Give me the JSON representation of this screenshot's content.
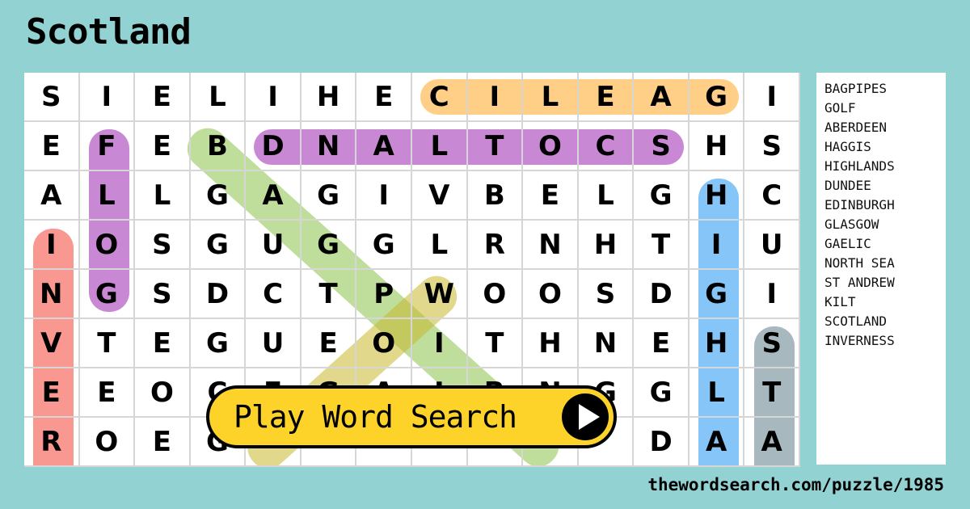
{
  "title": "Scotland",
  "grid": [
    [
      "S",
      "I",
      "E",
      "L",
      "I",
      "H",
      "E",
      "C",
      "I",
      "L",
      "E",
      "A",
      "G",
      "I"
    ],
    [
      "E",
      "F",
      "E",
      "B",
      "D",
      "N",
      "A",
      "L",
      "T",
      "O",
      "C",
      "S",
      "H",
      "S"
    ],
    [
      "A",
      "L",
      "L",
      "G",
      "A",
      "G",
      "I",
      "V",
      "B",
      "E",
      "L",
      "G",
      "H",
      "C"
    ],
    [
      "I",
      "O",
      "S",
      "G",
      "U",
      "G",
      "G",
      "L",
      "R",
      "N",
      "H",
      "T",
      "I",
      "U"
    ],
    [
      "N",
      "G",
      "S",
      "D",
      "C",
      "T",
      "P",
      "W",
      "O",
      "O",
      "S",
      "D",
      "G",
      "I"
    ],
    [
      "V",
      "T",
      "E",
      "G",
      "U",
      "E",
      "O",
      "I",
      "T",
      "H",
      "N",
      "E",
      "H",
      "S"
    ],
    [
      "E",
      "E",
      "O",
      "C",
      "E",
      "G",
      "A",
      "I",
      "R",
      "N",
      "G",
      "G",
      "L",
      "T"
    ],
    [
      "R",
      "O",
      "E",
      "G",
      "",
      "",
      "",
      "",
      "",
      "",
      "",
      "D",
      "A",
      "A"
    ]
  ],
  "found_words": [
    {
      "word": "GAELIC",
      "color": "#ffa726"
    },
    {
      "word": "SCOTLAND",
      "color": "#9c27b0"
    },
    {
      "word": "GOLF",
      "color": "#9c27b0"
    },
    {
      "word": "INVERNESS",
      "color": "#f44336"
    },
    {
      "word": "HIGHLANDS",
      "color": "#2196f3"
    },
    {
      "word": "HAGGIS",
      "color": "#8bc34a"
    },
    {
      "word": "GLASGOW",
      "color": "#c8b82e"
    },
    {
      "word": "ST ANDREW",
      "color": "#607d8b"
    }
  ],
  "word_list": [
    "BAGPIPES",
    "GOLF",
    "ABERDEEN",
    "HAGGIS",
    "HIGHLANDS",
    "DUNDEE",
    "EDINBURGH",
    "GLASGOW",
    "GAELIC",
    "NORTH SEA",
    "ST ANDREW",
    "KILT",
    "SCOTLAND",
    "INVERNESS"
  ],
  "play_button": {
    "label": "Play Word Search",
    "icon": "play-icon"
  },
  "footer_url": "thewordsearch.com/puzzle/1985"
}
